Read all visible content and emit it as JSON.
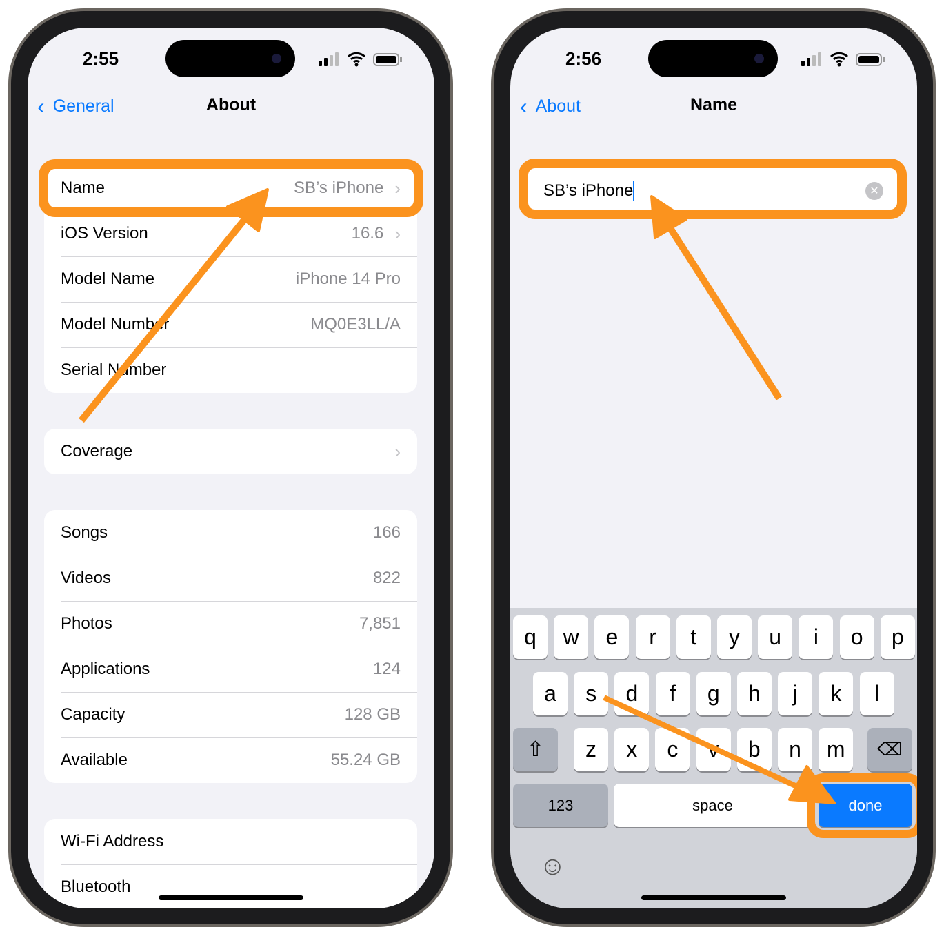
{
  "left": {
    "time": "2:55",
    "back_label": "General",
    "title": "About",
    "group1": [
      {
        "label": "Name",
        "value": "SB’s iPhone",
        "chevron": true
      },
      {
        "label": "iOS Version",
        "value": "16.6",
        "chevron": true
      },
      {
        "label": "Model Name",
        "value": "iPhone 14 Pro"
      },
      {
        "label": "Model Number",
        "value": "MQ0E3LL/A"
      },
      {
        "label": "Serial Number",
        "value": ""
      }
    ],
    "group2": [
      {
        "label": "Coverage",
        "value": "",
        "chevron": true
      }
    ],
    "group3": [
      {
        "label": "Songs",
        "value": "166"
      },
      {
        "label": "Videos",
        "value": "822"
      },
      {
        "label": "Photos",
        "value": "7,851"
      },
      {
        "label": "Applications",
        "value": "124"
      },
      {
        "label": "Capacity",
        "value": "128 GB"
      },
      {
        "label": "Available",
        "value": "55.24 GB"
      }
    ],
    "group4": [
      {
        "label": "Wi-Fi Address",
        "value": ""
      },
      {
        "label": "Bluetooth",
        "value": ""
      }
    ]
  },
  "right": {
    "time": "2:56",
    "back_label": "About",
    "title": "Name",
    "field_value": "SB’s iPhone",
    "keyboard": {
      "row1": [
        "q",
        "w",
        "e",
        "r",
        "t",
        "y",
        "u",
        "i",
        "o",
        "p"
      ],
      "row2": [
        "a",
        "s",
        "d",
        "f",
        "g",
        "h",
        "j",
        "k",
        "l"
      ],
      "row3": [
        "z",
        "x",
        "c",
        "v",
        "b",
        "n",
        "m"
      ],
      "numbers": "123",
      "space": "space",
      "done": "done"
    }
  },
  "colors": {
    "accent": "#0a7aff",
    "highlight": "#fb931e",
    "done_key": "#0a7aff"
  }
}
